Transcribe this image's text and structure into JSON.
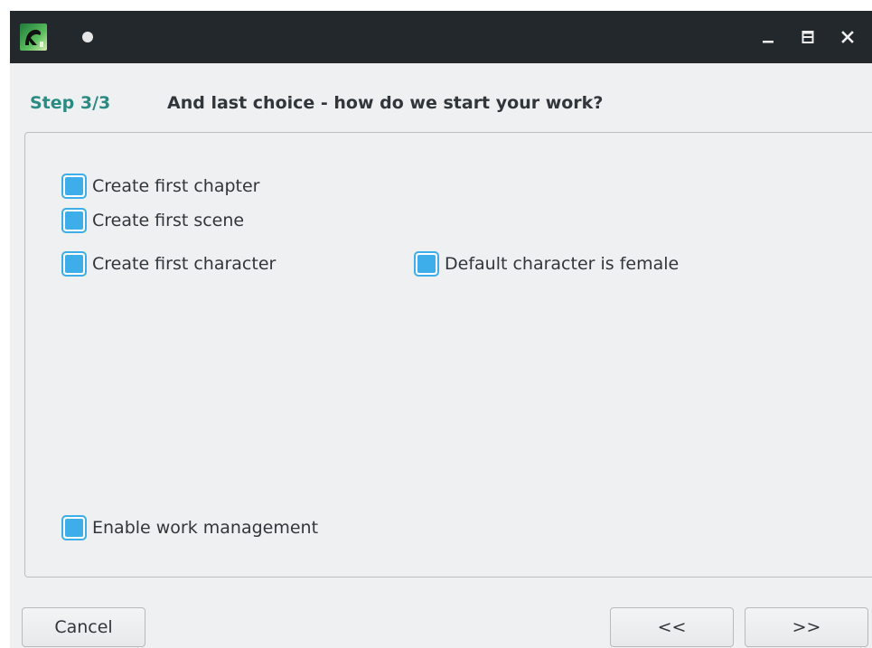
{
  "window": {
    "title_icon": "app-logo-icon",
    "status_dot": "modified-dot-icon",
    "controls": {
      "minimize_icon": "minimize-icon",
      "maximize_icon": "maximize-icon",
      "close_icon": "close-icon"
    }
  },
  "header": {
    "step": "Step 3/3",
    "title": "And last choice - how do we start your work?"
  },
  "options": [
    {
      "label": "Create first chapter",
      "checked": true
    },
    {
      "label": "Create first scene",
      "checked": true
    },
    {
      "label": "Create first character",
      "checked": true
    },
    {
      "label": "Default character is female",
      "checked": true
    },
    {
      "label": "Enable work management",
      "checked": true
    }
  ],
  "buttons": {
    "cancel": "Cancel",
    "back": "<<",
    "next": ">>"
  },
  "colors": {
    "titlebar": "#23282d",
    "background": "#eff0f1",
    "accent": "#3daee9",
    "step_label": "#2a8b83",
    "text": "#31363b"
  }
}
